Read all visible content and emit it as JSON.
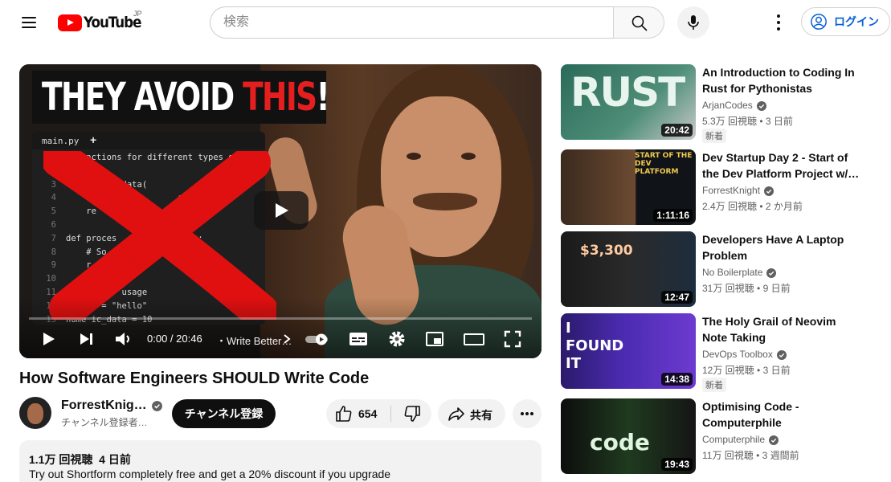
{
  "header": {
    "logo_text": "YouTube",
    "region": "JP",
    "search_placeholder": "検索",
    "login_label": "ログイン"
  },
  "player": {
    "thumbnail_headline": "THEY AVOID",
    "thumbnail_headline_accent": "THIS",
    "thumbnail_headline_suffix": "!",
    "editor_tab": "main.py",
    "editor_tab_plus": "+",
    "code_lines": [
      {
        "n": "1",
        "t": "# Functions for different types of data"
      },
      {
        "n": "2",
        "t": ""
      },
      {
        "n": "3",
        "t": "      text_data("
      },
      {
        "n": "4",
        "t": "        some          c here"
      },
      {
        "n": "5",
        "t": "    re"
      },
      {
        "n": "6",
        "t": ""
      },
      {
        "n": "7",
        "t": "def proces         a(data):"
      },
      {
        "n": "8",
        "t": "    # So             here"
      },
      {
        "n": "9",
        "t": "    r         *"
      },
      {
        "n": "10",
        "t": ""
      },
      {
        "n": "11",
        "t": "#          usage"
      },
      {
        "n": "12",
        "t": "t   ta = \"hello\""
      },
      {
        "n": "13",
        "t": "nume ic_data = 10"
      }
    ],
    "time": "0:00 / 20:46",
    "chapter": "・Write Better…",
    "progress": 0
  },
  "video": {
    "title": "How Software Engineers SHOULD Write Code",
    "channel": "ForrestKnig…",
    "subscribers": "チャンネル登録者…",
    "subscribe_label": "チャンネル登録",
    "likes": "654",
    "share_label": "共有",
    "views": "1.1万 回視聴",
    "age": "4 日前",
    "description": "Try out Shortform completely free and get a 20% discount if you upgrade"
  },
  "related": [
    {
      "title": "An Introduction to Coding In Rust for Pythonistas",
      "channel": "ArjanCodes",
      "views": "5.3万 回視聴",
      "age": "3 日前",
      "duration": "20:42",
      "badge": "新着",
      "thumb_text": "RUST"
    },
    {
      "title": "Dev Startup Day 2 - Start of the Dev Platform Project w/…",
      "channel": "ForrestKnight",
      "views": "2.4万 回視聴",
      "age": "2 か月前",
      "duration": "1:11:16",
      "badge": "",
      "thumb_text": "START OF THE DEV PLATFORM"
    },
    {
      "title": "Developers Have A Laptop Problem",
      "channel": "No Boilerplate",
      "views": "31万 回視聴",
      "age": "9 日前",
      "duration": "12:47",
      "badge": "",
      "thumb_text": "$3,300"
    },
    {
      "title": "The Holy Grail of Neovim Note Taking",
      "channel": "DevOps Toolbox",
      "views": "12万 回視聴",
      "age": "3 日前",
      "duration": "14:38",
      "badge": "新着",
      "thumb_text": "I FOUND IT"
    },
    {
      "title": "Optimising Code - Computerphile",
      "channel": "Computerphile",
      "views": "11万 回視聴",
      "age": "3 週間前",
      "duration": "19:43",
      "badge": "",
      "thumb_text": "code"
    }
  ],
  "icons": [
    "menu-icon",
    "search-icon",
    "mic-icon",
    "more-vert-icon",
    "account-icon",
    "play-icon",
    "next-icon",
    "volume-icon",
    "chevron-right-icon",
    "autoplay-toggle-icon",
    "subtitles-icon",
    "settings-icon",
    "miniplayer-icon",
    "theater-icon",
    "fullscreen-icon",
    "verified-icon",
    "thumb-up-icon",
    "thumb-down-icon",
    "share-icon",
    "more-horiz-icon"
  ],
  "colors": {
    "brand": "#ff0000",
    "link": "#065fd4",
    "text": "#0f0f0f",
    "secondary_text": "#606060"
  }
}
